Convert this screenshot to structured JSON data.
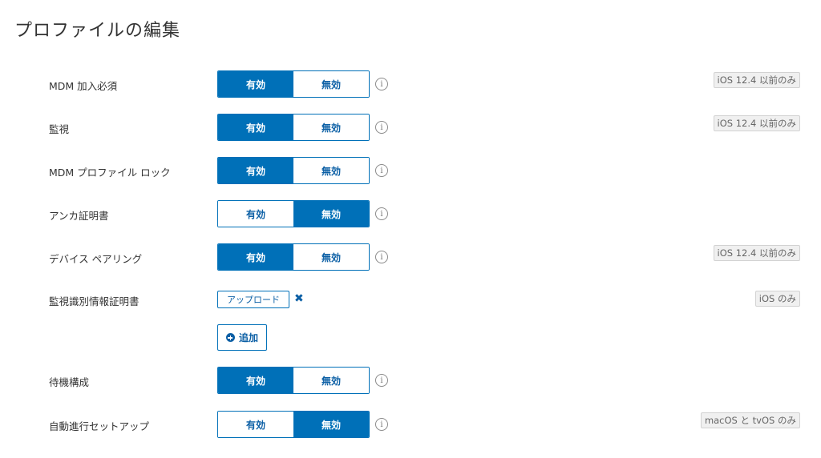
{
  "page": {
    "title": "プロファイルの編集"
  },
  "colors": {
    "accent": "#0070b8",
    "badge_bg": "#f0f0f0"
  },
  "toggle_labels": {
    "on": "有効",
    "off": "無効"
  },
  "rows": [
    {
      "label": "MDM 加入必須",
      "value": "有効",
      "badge": "iOS 12.4 以前のみ"
    },
    {
      "label": "監視",
      "value": "有効",
      "badge": "iOS 12.4 以前のみ"
    },
    {
      "label": "MDM プロファイル ロック",
      "value": "有効",
      "badge": ""
    },
    {
      "label": "アンカ証明書",
      "value": "無効",
      "badge": ""
    },
    {
      "label": "デバイス ペアリング",
      "value": "有効",
      "badge": "iOS 12.4 以前のみ"
    },
    {
      "label": "待機構成",
      "value": "有効",
      "badge": ""
    },
    {
      "label": "自動進行セットアップ",
      "value": "無効",
      "badge": "macOS と tvOS のみ"
    }
  ],
  "certificate": {
    "label": "監視識別情報証明書",
    "upload_label": "アップロード",
    "remove_icon": "close-icon",
    "badge": "iOS のみ",
    "add_label": "追加"
  },
  "icons": {
    "info": "info-icon",
    "add": "plus-circle-icon"
  }
}
